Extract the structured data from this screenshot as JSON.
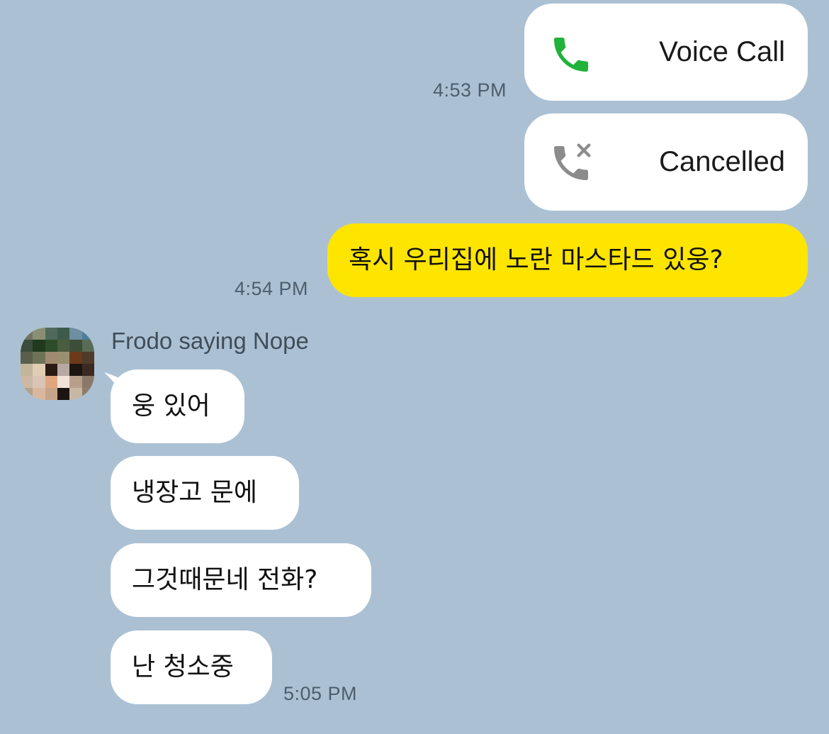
{
  "messages": {
    "outgoing": {
      "voice_call_label": "Voice Call",
      "voice_call_icon": "phone-icon",
      "voice_call_time": "4:53 PM",
      "cancelled_label": "Cancelled",
      "cancelled_icon": "phone-cancelled-icon",
      "text_message": "혹시 우리집에 노란 마스타드 있웅?",
      "text_time": "4:54 PM"
    },
    "incoming": {
      "sender_name": "Frodo saying Nope",
      "avatar": "pixelated-avatar",
      "bubbles": [
        "웅 있어",
        "냉장고 문에",
        "그것때문네 전화?",
        "난 청소중"
      ],
      "time": "5:05 PM"
    }
  },
  "colors": {
    "background": "#abc1d3",
    "outgoing_bubble": "#fee500",
    "incoming_bubble": "#ffffff",
    "call_green": "#20b23a",
    "cancelled_gray": "#8c8c8c"
  }
}
